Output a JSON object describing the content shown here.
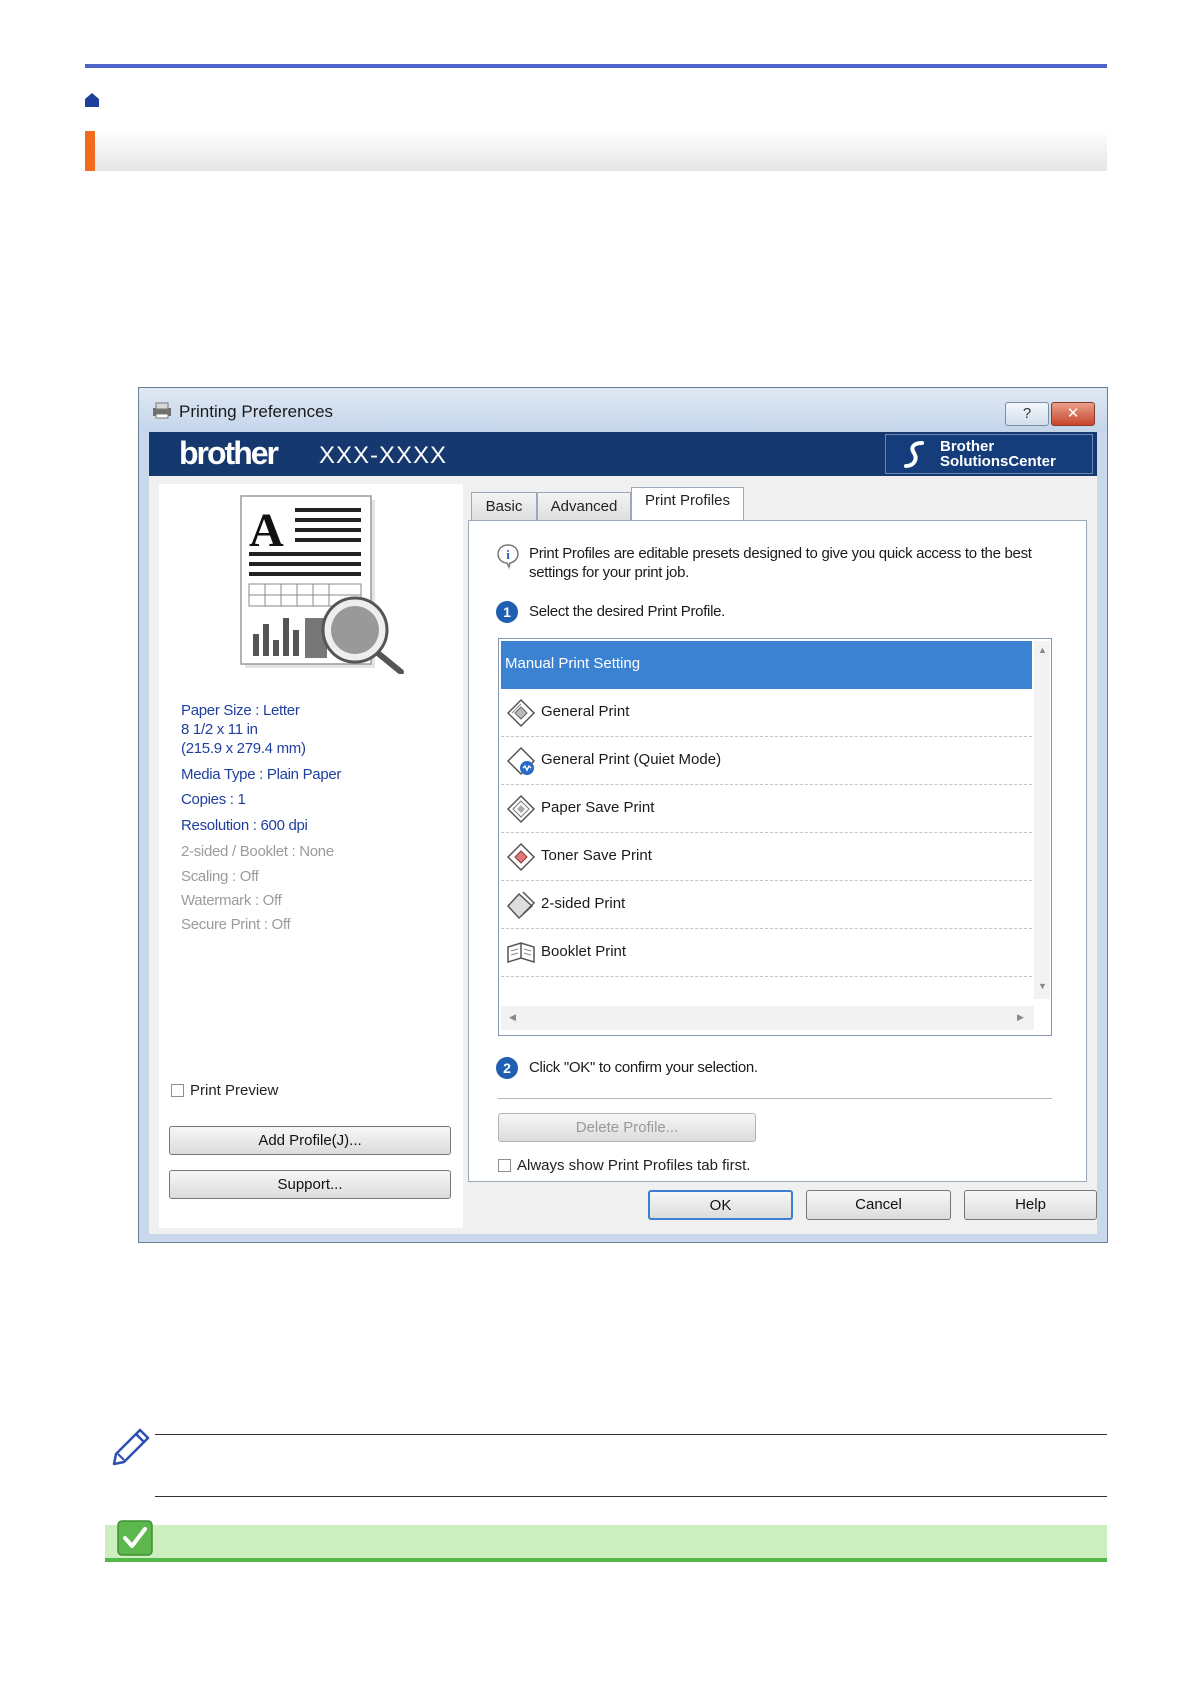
{
  "dialog": {
    "title": "Printing Preferences",
    "help_button": "?",
    "close_button": "✕",
    "brand": "brother",
    "model": "XXX-XXXX",
    "solutions_center": "Brother\nSolutionsCenter"
  },
  "left_panel": {
    "info": [
      {
        "text": "Paper Size : Letter",
        "enabled": true
      },
      {
        "text": "8 1/2 x 11 in",
        "enabled": true
      },
      {
        "text": "(215.9 x 279.4 mm)",
        "enabled": true
      },
      {
        "text": "Media Type : Plain Paper",
        "enabled": true
      },
      {
        "text": "Copies : 1",
        "enabled": true
      },
      {
        "text": "Resolution : 600 dpi",
        "enabled": true
      },
      {
        "text": "2-sided / Booklet : None",
        "enabled": false
      },
      {
        "text": "Scaling : Off",
        "enabled": false
      },
      {
        "text": "Watermark : Off",
        "enabled": false
      },
      {
        "text": "Secure Print : Off",
        "enabled": false
      }
    ],
    "print_preview_label": "Print Preview",
    "print_preview_checked": false,
    "add_profile_button": "Add Profile(J)...",
    "support_button": "Support..."
  },
  "tabs": [
    {
      "label": "Basic",
      "active": false
    },
    {
      "label": "Advanced",
      "active": false
    },
    {
      "label": "Print Profiles",
      "active": true
    }
  ],
  "profiles_tab": {
    "intro": "Print Profiles are editable presets designed to give you quick access to the best settings for your print job.",
    "step1_number": "1",
    "step1_text": "Select the desired Print Profile.",
    "profiles": [
      {
        "label": "Manual Print Setting",
        "selected": true,
        "icon": "none"
      },
      {
        "label": "General Print",
        "selected": false,
        "icon": "profile-paper-icon"
      },
      {
        "label": "General Print (Quiet Mode)",
        "selected": false,
        "icon": "profile-quiet-icon"
      },
      {
        "label": "Paper Save Print",
        "selected": false,
        "icon": "profile-paper-icon"
      },
      {
        "label": "Toner Save Print",
        "selected": false,
        "icon": "profile-toner-icon"
      },
      {
        "label": "2-sided Print",
        "selected": false,
        "icon": "profile-duplex-icon"
      },
      {
        "label": "Booklet Print",
        "selected": false,
        "icon": "profile-booklet-icon"
      }
    ],
    "step2_number": "2",
    "step2_text": "Click \"OK\" to confirm your selection.",
    "delete_profile_button": "Delete Profile...",
    "always_show_label": "Always show Print Profiles tab first.",
    "always_show_checked": false
  },
  "footer_buttons": {
    "ok": "OK",
    "cancel": "Cancel",
    "help": "Help"
  },
  "colors": {
    "top_rule": "#4f64c8",
    "title_accent": "#f26b1d",
    "brand_bar": "#15386f",
    "selection": "#3b83d2",
    "check_band": "#cdeebe",
    "check_rule": "#52b84a"
  }
}
